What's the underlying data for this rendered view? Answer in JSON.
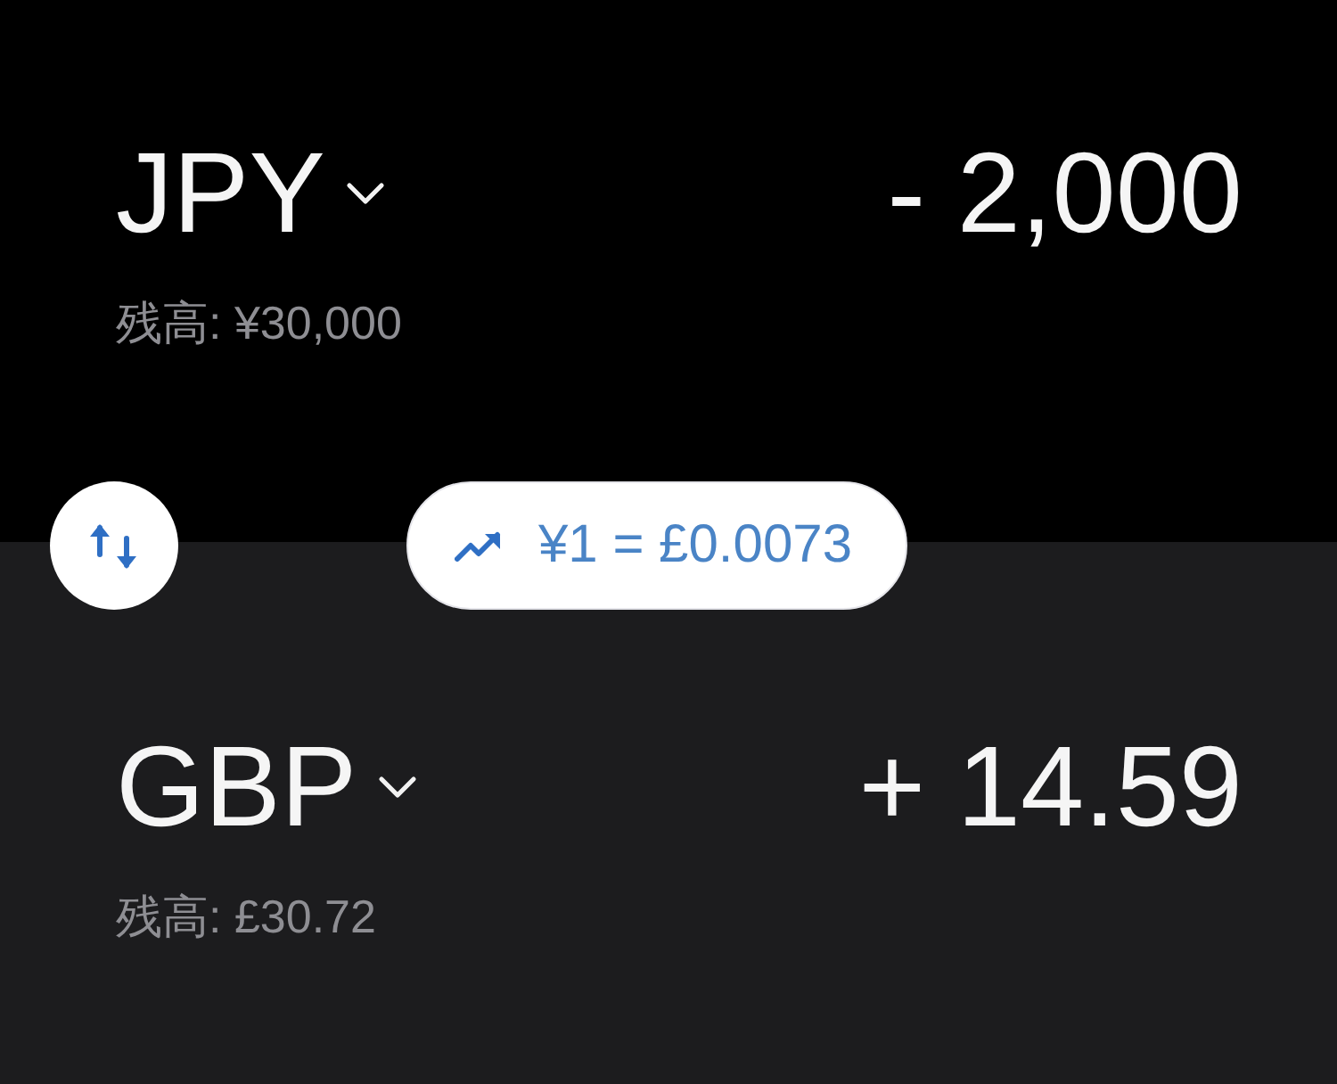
{
  "exchange_rows": [
    {
      "kind": "sell",
      "currency": "JPY",
      "amount": "- 2,000",
      "balance": "残高: ¥30,000"
    },
    {
      "kind": "buy",
      "currency": "GBP",
      "amount": "+ 14.59",
      "balance": "残高: £30.72"
    }
  ],
  "rate": {
    "text": "¥1 = £0.0073"
  }
}
